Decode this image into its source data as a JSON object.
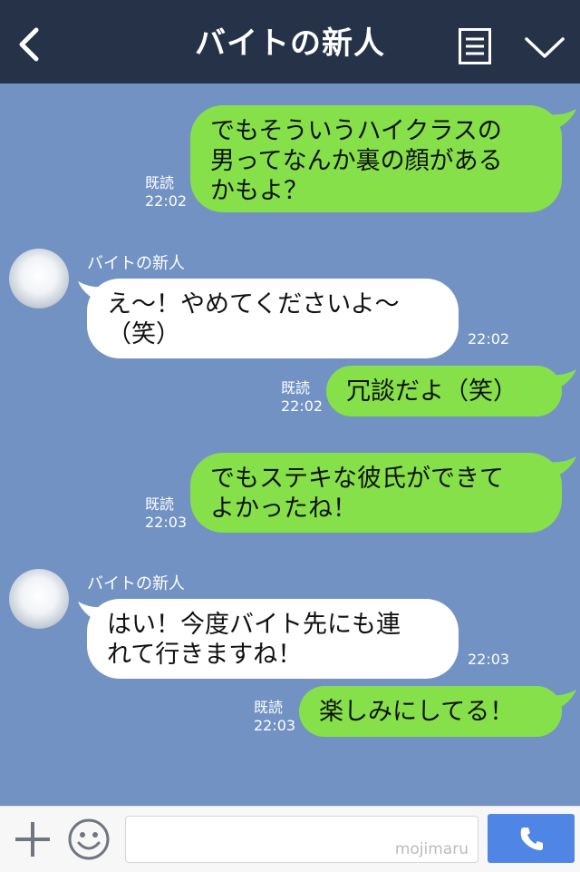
{
  "header": {
    "title": "バイトの新人"
  },
  "messages": [
    {
      "side": "right",
      "text": "でもそういうハイクラスの\n男ってなんか裏の顔がある\nかもよ？",
      "read": "既読",
      "time": "22:02"
    },
    {
      "side": "left",
      "sender": "バイトの新人",
      "text": "え〜！やめてくださいよ〜\n（笑）",
      "time": "22:02"
    },
    {
      "side": "right",
      "text": "冗談だよ（笑）",
      "read": "既読",
      "time": "22:02"
    },
    {
      "side": "right",
      "text": "でもステキな彼氏ができて\nよかったね！",
      "read": "既読",
      "time": "22:03"
    },
    {
      "side": "left",
      "sender": "バイトの新人",
      "text": "はい！今度バイト先にも連\nれて行きますね！",
      "time": "22:03"
    },
    {
      "side": "right",
      "text": "楽しみにしてる！",
      "read": "既読",
      "time": "22:03"
    }
  ],
  "footer": {
    "watermark": "mojimaru"
  },
  "colors": {
    "background": "#7292c4",
    "header": "#253247",
    "bubble_out": "#86e04a",
    "bubble_in": "#ffffff",
    "call_button": "#4f86e6"
  },
  "icons": [
    "back-icon",
    "menu-icon",
    "chevron-down-icon",
    "plus-icon",
    "smile-icon",
    "phone-icon"
  ]
}
